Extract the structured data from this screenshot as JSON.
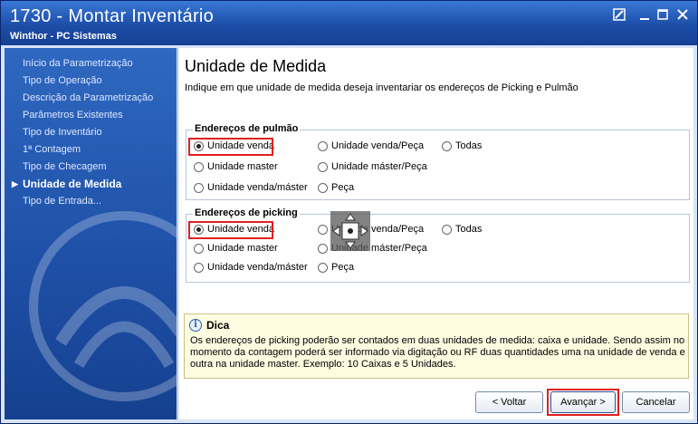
{
  "window": {
    "title": "1730 - Montar Inventário",
    "subtitle": "Winthor - PC Sistemas"
  },
  "window_controls": [
    "restore-icon",
    "minimize-icon",
    "maximize-icon",
    "close-icon"
  ],
  "sidebar": {
    "items": [
      {
        "label": "Início da Parametrização",
        "active": false
      },
      {
        "label": "Tipo de Operação",
        "active": false
      },
      {
        "label": "Descrição da Parametrização",
        "active": false
      },
      {
        "label": "Parâmetros Existentes",
        "active": false
      },
      {
        "label": "Tipo de Inventário",
        "active": false
      },
      {
        "label": "1ª Contagem",
        "active": false
      },
      {
        "label": "Tipo de Checagem",
        "active": false
      },
      {
        "label": "Unidade de Medida",
        "active": true
      },
      {
        "label": "Tipo de Entrada...",
        "active": false
      }
    ]
  },
  "main": {
    "title": "Unidade de Medida",
    "description": "Indique em que unidade de medida deseja inventariar os endereços de Picking e Pulmão",
    "pulmao": {
      "title": "Endereços de pulmão",
      "options": [
        "Unidade venda",
        "Unidade venda/Peça",
        "Todas",
        "Unidade master",
        "Unidade máster/Peça",
        "Unidade venda/máster",
        "Peça"
      ],
      "selected": "Unidade venda"
    },
    "picking": {
      "title": "Endereços de picking",
      "options": [
        "Unidade venda",
        "Unidade venda/Peça",
        "Todas",
        "Unidade master",
        "Unidade máster/Peça",
        "Unidade venda/máster",
        "Peça"
      ],
      "selected": "Unidade venda"
    },
    "tip": {
      "title": "Dica",
      "text": "Os endereços de picking poderão ser contados em duas unidades de medida: caixa e unidade. Sendo assim no momento da contagem poderá ser informado via digitação ou RF duas quantidades uma na unidade de venda e outra na unidade master. Exemplo: 10 Caixas e 5 Unidades."
    }
  },
  "footer": {
    "back_label": "< Voltar",
    "next_label": "Avançar >",
    "cancel_label": "Cancelar"
  },
  "colors": {
    "titlebar": "#1c4ea8",
    "sidebar": "#1e4fa6",
    "highlight": "#e02020",
    "tip_bg": "#fdfbe0"
  }
}
